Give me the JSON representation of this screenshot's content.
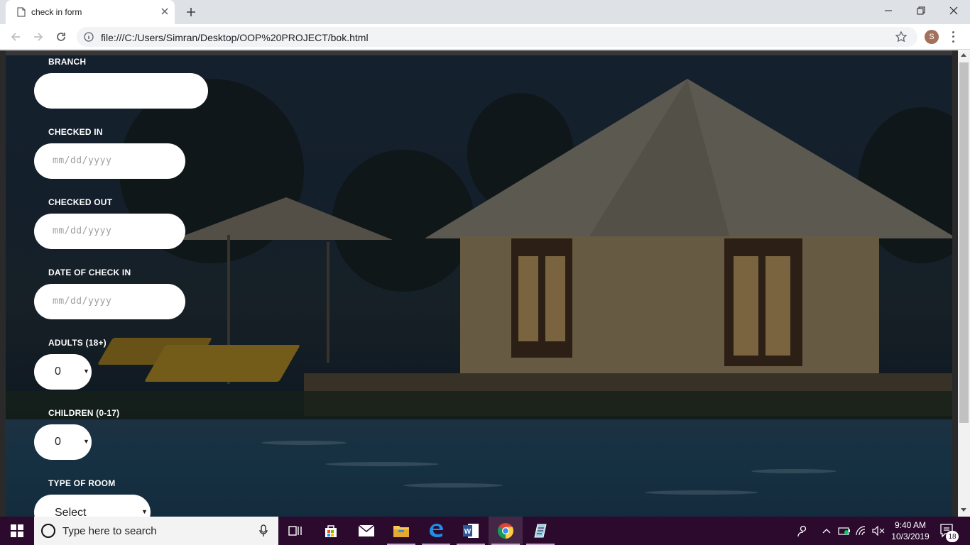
{
  "browser": {
    "tab_title": "check in form",
    "url": "file:///C:/Users/Simran/Desktop/OOP%20PROJECT/bok.html",
    "profile_initial": "S"
  },
  "form": {
    "branch": {
      "label": "BRANCH",
      "value": ""
    },
    "checked_in": {
      "label": "CHECKED IN",
      "placeholder": "mm/dd/yyyy"
    },
    "checked_out": {
      "label": "CHECKED OUT",
      "placeholder": "mm/dd/yyyy"
    },
    "date_of_check_in": {
      "label": "DATE OF CHECK IN",
      "placeholder": "mm/dd/yyyy"
    },
    "adults": {
      "label": "ADULTS (18+)",
      "value": "0"
    },
    "children": {
      "label": "CHILDREN (0-17)",
      "value": "0"
    },
    "room_type": {
      "label": "TYPE OF ROOM",
      "value": "Select"
    }
  },
  "taskbar": {
    "search_placeholder": "Type here to search",
    "time": "9:40 AM",
    "date": "10/3/2019",
    "notification_count": "18"
  },
  "colors": {
    "taskbar": "#2b0a2e",
    "field_bg": "#ffffff",
    "label_text": "#ffffff"
  }
}
